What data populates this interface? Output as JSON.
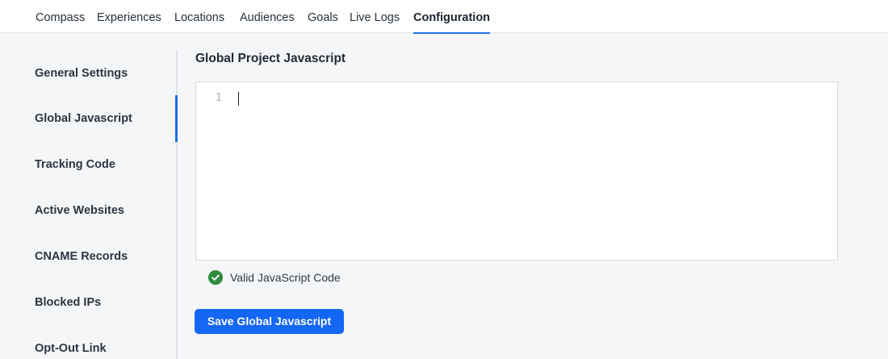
{
  "topnav": {
    "tabs": [
      {
        "label": "Compass"
      },
      {
        "label": "Experiences"
      },
      {
        "label": "Locations"
      },
      {
        "label": "Audiences"
      },
      {
        "label": "Goals"
      },
      {
        "label": "Live Logs"
      },
      {
        "label": "Configuration",
        "active": true
      }
    ]
  },
  "sidenav": {
    "items": [
      {
        "label": "General Settings"
      },
      {
        "label": "Global Javascript",
        "active": true
      },
      {
        "label": "Tracking Code"
      },
      {
        "label": "Active Websites"
      },
      {
        "label": "CNAME Records"
      },
      {
        "label": "Blocked IPs"
      },
      {
        "label": "Opt-Out Link"
      }
    ]
  },
  "main": {
    "title": "Global Project Javascript",
    "editor": {
      "line_numbers": [
        "1"
      ],
      "content": ""
    },
    "validation": {
      "icon": "check-circle-icon",
      "text": "Valid JavaScript Code",
      "color": "#2e8b3e"
    },
    "save_label": "Save Global Javascript"
  },
  "colors": {
    "accent": "#1467f5",
    "active_indicator": "#1f6feb"
  }
}
